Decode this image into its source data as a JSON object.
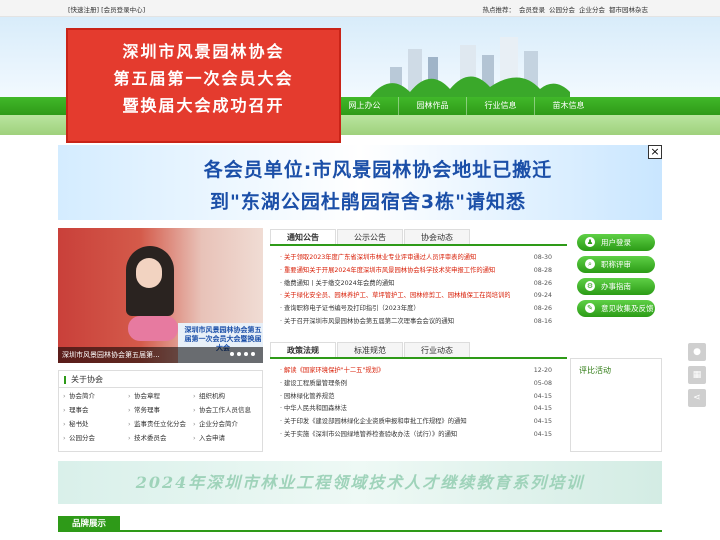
{
  "topbar": {
    "left": "[快速注册] [会员登录中心]",
    "hot_label": "热点推荐：",
    "hot_links": [
      "会员登录",
      "公园分会",
      "企业分会",
      "都市园林杂志"
    ]
  },
  "popup": {
    "line1": "深圳市风景园林协会",
    "line2": "第五届第一次会员大会",
    "line3": "暨换届大会成功召开"
  },
  "nav": {
    "items": [
      "网上办公",
      "园林作品",
      "行业信息",
      "苗木信息"
    ]
  },
  "banner": {
    "line1": "各会员单位:市风景园林协会地址已搬迁",
    "line2": "到\"东湖公园杜鹃园宿舍3栋\"请知悉",
    "close_label": "×"
  },
  "slider": {
    "caption": "深圳市风景园林协会第五届第...",
    "board_text": "深圳市风景园林协会第五届第一次会员大会暨换届大会"
  },
  "about": {
    "title": "关于协会",
    "links": [
      "协会简介",
      "协会章程",
      "组织机构",
      "理事会",
      "常务理事",
      "协会工作人员信息",
      "秘书处",
      "监事责任立化分会",
      "企业分会简介",
      "公园分会",
      "技术委员会",
      "入会申请"
    ]
  },
  "tabs1": {
    "items": [
      "通知公告",
      "公示公告",
      "协会动态"
    ]
  },
  "news1": [
    {
      "text": "关于领取2023年度广东省深圳市林业专业评审通过人员评审表的通知",
      "date": "08-30",
      "red": true
    },
    {
      "text": "重要通知关于开展2024年度深圳市风景园林协会科学技术奖申报工作的通知",
      "date": "08-28",
      "red": true
    },
    {
      "text": "缴费通知丨关于缴交2024年会费的通知",
      "date": "08-26",
      "red": false
    },
    {
      "text": "关于绿化安全员、园林养护工、草坪管护工、园林修剪工、园林植保工在岗培训的...",
      "date": "09-24",
      "red": true
    },
    {
      "text": "查询职称电子证书编号及打印指引（2023年度）",
      "date": "08-26",
      "red": false
    },
    {
      "text": "关于召开深圳市风景园林协会第五届第二次理事会会议的通知",
      "date": "08-16",
      "red": false
    }
  ],
  "tabs2": {
    "items": [
      "政策法规",
      "标准规范",
      "行业动态"
    ]
  },
  "news2": [
    {
      "text": "解读《国家环境保护\"十二五\"规划》",
      "date": "12-20",
      "red": true
    },
    {
      "text": "建设工程质量管理条例",
      "date": "05-08",
      "red": false
    },
    {
      "text": "园林绿化管养规范",
      "date": "04-15",
      "red": false
    },
    {
      "text": "中华人民共和国森林法",
      "date": "04-15",
      "red": false
    },
    {
      "text": "关于印发《建设部园林绿化企业资质申报和审批工作规程》的通知",
      "date": "04-15",
      "red": false
    },
    {
      "text": "关于实施《深圳市公园绿地管养检查验收办法（试行）》的通知",
      "date": "04-15",
      "red": false
    }
  ],
  "quick": {
    "items": [
      {
        "label": "用户登录",
        "icon": "user-icon",
        "glyph": "♟"
      },
      {
        "label": "职称评审",
        "icon": "search-icon",
        "glyph": "⌕"
      },
      {
        "label": "办事指南",
        "icon": "gear-icon",
        "glyph": "⚙"
      },
      {
        "label": "意见收集及反馈",
        "icon": "document-icon",
        "glyph": "✎"
      }
    ]
  },
  "pingbi": {
    "title": "评比活动"
  },
  "training": {
    "title": "2024年深圳市林业工程领域技术人才继续教育系列培训"
  },
  "brand": {
    "title": "品牌展示"
  },
  "colors": {
    "green": "#2e9a18",
    "red": "#d81e06",
    "popup_red": "#e43b2e",
    "banner_blue": "#1b4fa8"
  }
}
